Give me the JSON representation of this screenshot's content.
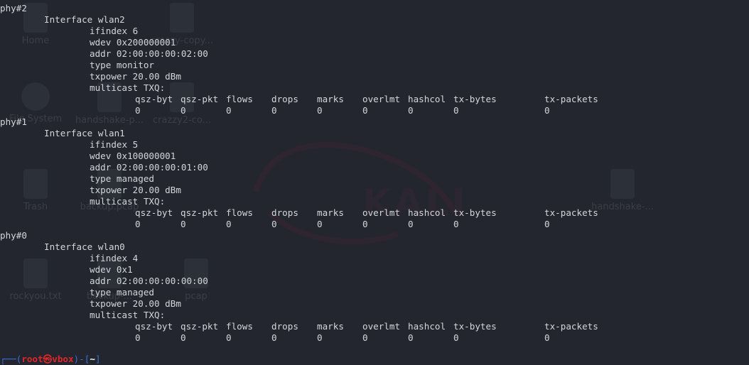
{
  "desktop_icons": [
    {
      "id": "home",
      "label": "Home"
    },
    {
      "id": "crazzy-copy",
      "label": "crazzy-copy..."
    },
    {
      "id": "file-system",
      "label": "File System"
    },
    {
      "id": "handshake-p",
      "label": "handshake-p..."
    },
    {
      "id": "crazzy2-co",
      "label": "crazzy2-co..."
    },
    {
      "id": "trash",
      "label": "Trash"
    },
    {
      "id": "backup-pcap",
      "label": "backup.pcap"
    },
    {
      "id": "handshake-2",
      "label": "handshake-..."
    },
    {
      "id": "rockyou",
      "label": "rockyou.txt"
    },
    {
      "id": "backup2",
      "label": "backup-..."
    },
    {
      "id": "pcap",
      "label": "pcap"
    }
  ],
  "watermark": "KALI",
  "terminal": {
    "interfaces": [
      {
        "phy": "phy#2",
        "interface": "Interface wlan2",
        "ifindex": "ifindex 6",
        "wdev": "wdev 0x200000001",
        "addr": "addr 02:00:00:00:02:00",
        "type": "type monitor",
        "txpower": "txpower 20.00 dBm",
        "multicast": "multicast TXQ:"
      },
      {
        "phy": "phy#1",
        "interface": "Interface wlan1",
        "ifindex": "ifindex 5",
        "wdev": "wdev 0x100000001",
        "addr": "addr 02:00:00:00:01:00",
        "type": "type managed",
        "txpower": "txpower 20.00 dBm",
        "multicast": "multicast TXQ:"
      },
      {
        "phy": "phy#0",
        "interface": "Interface wlan0",
        "ifindex": "ifindex 4",
        "wdev": "wdev 0x1",
        "addr": "addr 02:00:00:00:00:00",
        "type": "type managed",
        "txpower": "txpower 20.00 dBm",
        "multicast": "multicast TXQ:"
      }
    ],
    "txq_headers": [
      "qsz-byt",
      "qsz-pkt",
      "flows",
      "drops",
      "marks",
      "overlmt",
      "hashcol",
      "tx-bytes",
      "tx-packets"
    ],
    "txq_values": [
      "0",
      "0",
      "0",
      "0",
      "0",
      "0",
      "0",
      "0",
      "0"
    ],
    "prompt": {
      "open": "┌──(",
      "user_host": "root㉿vbox",
      "close": ")-[",
      "path": "~",
      "end": "]"
    }
  }
}
